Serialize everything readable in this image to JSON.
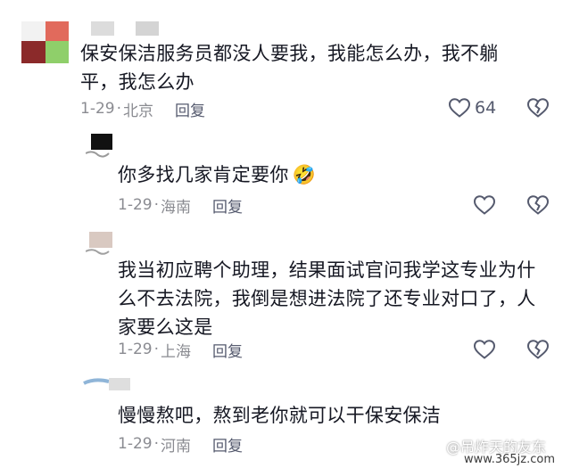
{
  "comments": [
    {
      "text": "保安保洁服务员都没人要我，我能怎么办，我不躺平，我怎么办",
      "date": "1-29",
      "sep": "·",
      "location": "北京",
      "reply_label": "回复",
      "like_count": "64"
    },
    {
      "text": "你多找几家肯定要你",
      "emoji": "🤣",
      "date": "1-29",
      "sep": "·",
      "location": "海南",
      "reply_label": "回复"
    },
    {
      "text": "我当初应聘个助理，结果面试官问我学这专业为什么不去法院，我倒是想进法院了还专业对口了，人家要么这是",
      "date": "1-29",
      "sep": "·",
      "location": "上海",
      "reply_label": "回复"
    },
    {
      "text": "慢慢熬吧，熬到老你就可以干保安保洁",
      "date": "1-29",
      "sep": "·",
      "location": "河南",
      "reply_label": "回复"
    }
  ],
  "watermark": {
    "text": "@吊炸天的友东",
    "url": "www.365jz.com"
  },
  "colors": {
    "text": "#161823",
    "meta": "#8a8b91",
    "reply": "#555a6e"
  }
}
